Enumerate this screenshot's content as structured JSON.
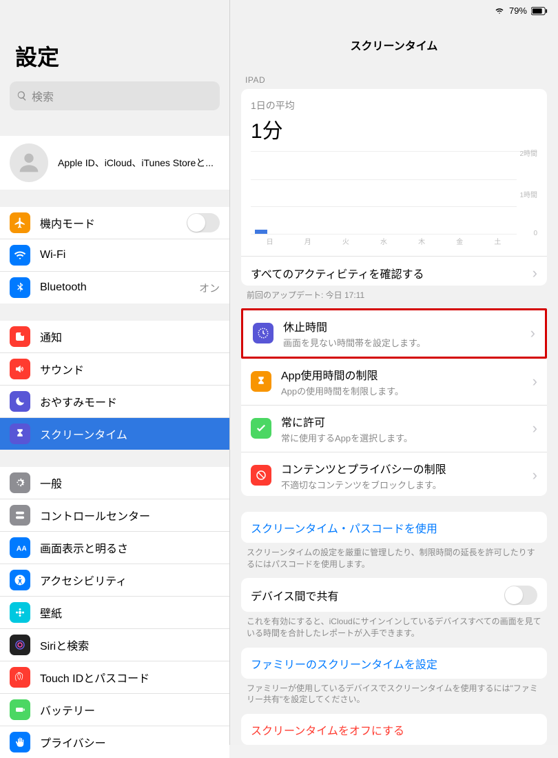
{
  "status": {
    "battery": "79%"
  },
  "sidebar": {
    "title": "設定",
    "search_placeholder": "検索",
    "apple_id_sub": "Apple ID、iCloud、iTunes Storeと...",
    "items": {
      "airplane": "機内モード",
      "wifi": "Wi-Fi",
      "bluetooth": "Bluetooth",
      "bt_value": "オン",
      "notify": "通知",
      "sound": "サウンド",
      "dnd": "おやすみモード",
      "screentime": "スクリーンタイム",
      "general": "一般",
      "cc": "コントロールセンター",
      "display": "画面表示と明るさ",
      "access": "アクセシビリティ",
      "wallpaper": "壁紙",
      "siri": "Siriと検索",
      "touchid": "Touch IDとパスコード",
      "battery": "バッテリー",
      "privacy": "プライバシー"
    }
  },
  "detail": {
    "title": "スクリーンタイム",
    "section1": "IPAD",
    "avg_label": "1日の平均",
    "avg_value": "1分",
    "chart": {
      "y_labels": [
        "2時間",
        "1時間",
        "0"
      ],
      "days": [
        "日",
        "月",
        "火",
        "水",
        "木",
        "金",
        "土"
      ]
    },
    "all_activity": "すべてのアクティビティを確認する",
    "last_update": "前回のアップデート: 今日 17:11",
    "opts": {
      "downtime": {
        "t": "休止時間",
        "s": "画面を見ない時間帯を設定します。"
      },
      "limits": {
        "t": "App使用時間の制限",
        "s": "Appの使用時間を制限します。"
      },
      "always": {
        "t": "常に許可",
        "s": "常に使用するAppを選択します。"
      },
      "content": {
        "t": "コンテンツとプライバシーの制限",
        "s": "不適切なコンテンツをブロックします。"
      }
    },
    "passcode_link": "スクリーンタイム・パスコードを使用",
    "passcode_note": "スクリーンタイムの設定を厳重に管理したり、制限時間の延長を許可したりするにはパスコードを使用します。",
    "share_label": "デバイス間で共有",
    "share_note": "これを有効にすると、iCloudにサインインしているデバイスすべての画面を見ている時間を合計したレポートが入手できます。",
    "family_link": "ファミリーのスクリーンタイムを設定",
    "family_note": "ファミリーが使用しているデバイスでスクリーンタイムを使用するには\"ファミリー共有\"を設定してください。",
    "off_link": "スクリーンタイムをオフにする"
  }
}
